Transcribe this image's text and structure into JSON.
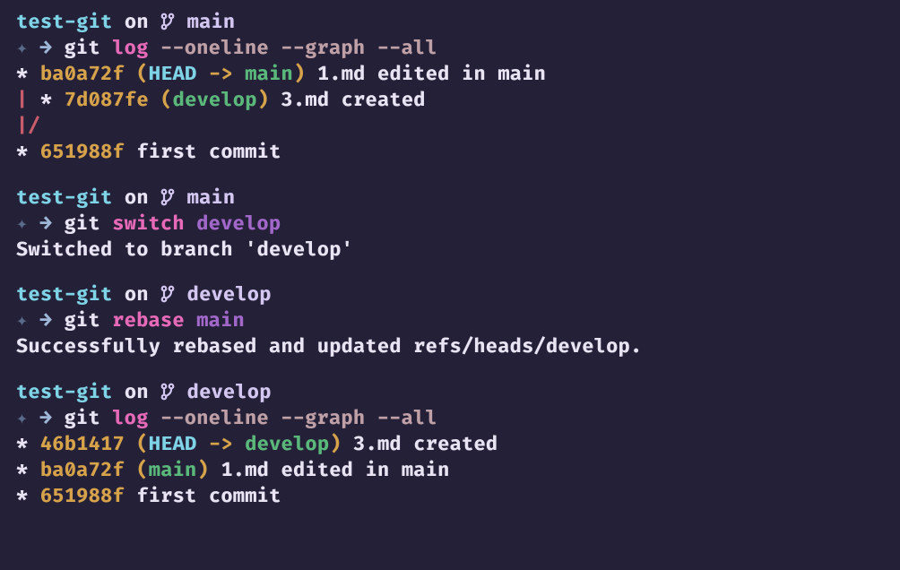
{
  "prompts": [
    {
      "dir": "test-git",
      "on": "on",
      "branch": "main",
      "diamond": "✦",
      "arrow": "→",
      "cmd": "git",
      "sub": "log",
      "args": [],
      "flags": [
        "--oneline",
        "--graph",
        "--all"
      ],
      "output_lines": [
        {
          "type": "commit",
          "prefix": "* ",
          "hash": "ba0a72f",
          "refs": [
            "HEAD",
            "->",
            "main"
          ],
          "msg": "1.md edited in main"
        },
        {
          "type": "commit",
          "prefix": "| * ",
          "hash": "7d087fe",
          "refs": [
            "develop"
          ],
          "msg": "3.md created"
        },
        {
          "type": "graph",
          "text": "|/"
        },
        {
          "type": "commit",
          "prefix": "* ",
          "hash": "651988f",
          "refs": [],
          "msg": "first commit"
        }
      ]
    },
    {
      "dir": "test-git",
      "on": "on",
      "branch": "main",
      "diamond": "✦",
      "arrow": "→",
      "cmd": "git",
      "sub": "switch",
      "args": [
        "develop"
      ],
      "flags": [],
      "output_lines": [
        {
          "type": "plain",
          "text": "Switched to branch 'develop'"
        }
      ]
    },
    {
      "dir": "test-git",
      "on": "on",
      "branch": "develop",
      "diamond": "✦",
      "arrow": "→",
      "cmd": "git",
      "sub": "rebase",
      "args": [
        "main"
      ],
      "flags": [],
      "output_lines": [
        {
          "type": "plain",
          "text": "Successfully rebased and updated refs/heads/develop."
        }
      ]
    },
    {
      "dir": "test-git",
      "on": "on",
      "branch": "develop",
      "diamond": "✦",
      "arrow": "→",
      "cmd": "git",
      "sub": "log",
      "args": [],
      "flags": [
        "--oneline",
        "--graph",
        "--all"
      ],
      "output_lines": [
        {
          "type": "commit",
          "prefix": "* ",
          "hash": "46b1417",
          "refs": [
            "HEAD",
            "->",
            "develop"
          ],
          "msg": "3.md created"
        },
        {
          "type": "commit",
          "prefix": "* ",
          "hash": "ba0a72f",
          "refs": [
            "main"
          ],
          "msg": "1.md edited in main"
        },
        {
          "type": "commit",
          "prefix": "* ",
          "hash": "651988f",
          "refs": [],
          "msg": "first commit"
        }
      ]
    }
  ],
  "colors": {
    "bg": "#242038",
    "dir": "#7ed4e6",
    "sub": "#e76ab9",
    "hash": "#d6a24a",
    "ref": "#5ab87a",
    "pipe": "#c85c6a"
  }
}
